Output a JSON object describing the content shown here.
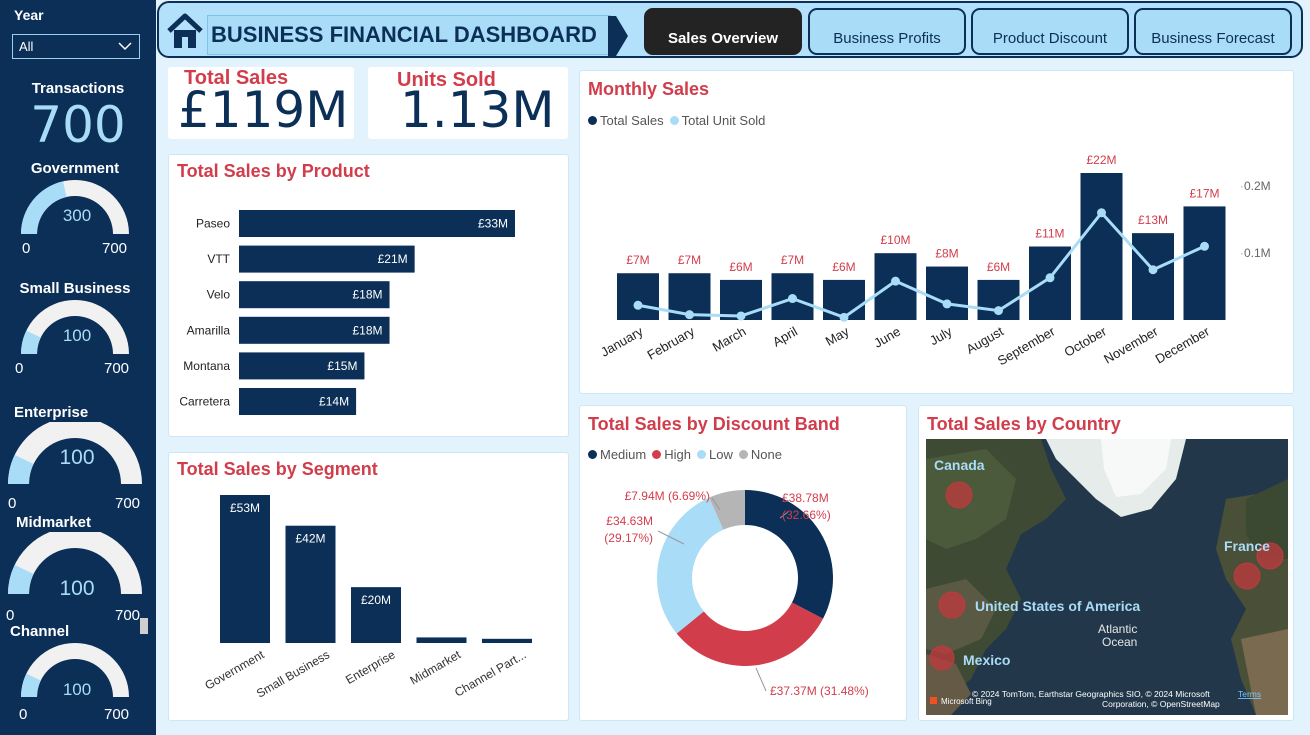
{
  "sidebar": {
    "year_label": "Year",
    "year_value": "All",
    "transactions_label": "Transactions",
    "transactions_value": "700",
    "gauges": [
      {
        "title": "Government",
        "value": 300,
        "value_text": "300",
        "min": "0",
        "max": "700"
      },
      {
        "title": "Small Business",
        "value": 100,
        "value_text": "100",
        "min": "0",
        "max": "700"
      },
      {
        "title": "Enterprise",
        "value": 100,
        "value_text": "100",
        "min": "0",
        "max": "700"
      },
      {
        "title": "Midmarket",
        "value": 100,
        "value_text": "100",
        "min": "0",
        "max": "700"
      },
      {
        "title": "Channel",
        "value": 100,
        "value_text": "100",
        "min": "0",
        "max": "700"
      }
    ]
  },
  "header": {
    "title": "BUSINESS FINANCIAL DASHBOARD",
    "tabs": [
      "Sales Overview",
      "Business Profits",
      "Product Discount",
      "Business Forecast"
    ],
    "active_tab": 0
  },
  "kpis": {
    "total_sales_label": "Total Sales",
    "total_sales_value": "£119M",
    "units_sold_label": "Units Sold",
    "units_sold_value": "1.13M"
  },
  "colors": {
    "navy": "#0c2f57",
    "light_blue": "#a9dcf7",
    "red": "#d23d4c",
    "grey": "#b5b5b5"
  },
  "chart_data": [
    {
      "id": "product",
      "type": "bar",
      "orientation": "horizontal",
      "title": "Total Sales by Product",
      "categories": [
        "Paseo",
        "VTT",
        "Velo",
        "Amarilla",
        "Montana",
        "Carretera"
      ],
      "values": [
        33,
        21,
        18,
        18,
        15,
        14
      ],
      "labels": [
        "£33M",
        "£21M",
        "£18M",
        "£18M",
        "£15M",
        "£14M"
      ]
    },
    {
      "id": "segment",
      "type": "bar",
      "title": "Total Sales by Segment",
      "categories": [
        "Government",
        "Small Business",
        "Enterprise",
        "Midmarket",
        "Channel Part..."
      ],
      "values": [
        53,
        42,
        20,
        2,
        1.5
      ],
      "labels": [
        "£53M",
        "£42M",
        "£20M",
        "",
        ""
      ]
    },
    {
      "id": "monthly",
      "type": "bar",
      "title": "Monthly Sales",
      "legend": [
        "Total Sales",
        "Total Unit Sold"
      ],
      "categories": [
        "January",
        "February",
        "March",
        "April",
        "May",
        "June",
        "July",
        "August",
        "September",
        "October",
        "November",
        "December"
      ],
      "series": [
        {
          "name": "Total Sales",
          "values": [
            7,
            7,
            6,
            7,
            6,
            10,
            8,
            6,
            11,
            22,
            13,
            17
          ],
          "labels": [
            "£7M",
            "£7M",
            "£6M",
            "£7M",
            "£6M",
            "£10M",
            "£8M",
            "£6M",
            "£11M",
            "£22M",
            "£13M",
            "£17M"
          ]
        },
        {
          "name": "Total Unit Sold",
          "values": [
            0.022,
            0.008,
            0.006,
            0.032,
            0.004,
            0.058,
            0.024,
            0.014,
            0.063,
            0.16,
            0.075,
            0.11
          ]
        }
      ],
      "y2_ticks": [
        "0.1M",
        "0.2M"
      ],
      "y2_values": [
        0.1,
        0.2
      ]
    },
    {
      "id": "discount",
      "type": "pie",
      "title": "Total Sales by Discount Band",
      "legend": [
        "Medium",
        "High",
        "Low",
        "None"
      ],
      "values": [
        38.78,
        37.37,
        34.63,
        7.94
      ],
      "labels": [
        [
          "£38.78M",
          "(32.66%)"
        ],
        [
          "£37.37M (31.48%)"
        ],
        [
          "£34.63M",
          "(29.17%)"
        ],
        [
          "£7.94M (6.69%)"
        ]
      ]
    }
  ],
  "map": {
    "title": "Total Sales by Country",
    "countries": [
      "Canada",
      "France",
      "United States of America",
      "Mexico"
    ],
    "ocean_label": [
      "Atlantic",
      "Ocean"
    ],
    "attribution": "© 2024 TomTom, Earthstar Geographics SIO, © 2024 Microsoft",
    "attribution2": "Corporation, © OpenStreetMap",
    "terms": "Terms",
    "bing": "Microsoft Bing"
  },
  "more_icon": "..."
}
